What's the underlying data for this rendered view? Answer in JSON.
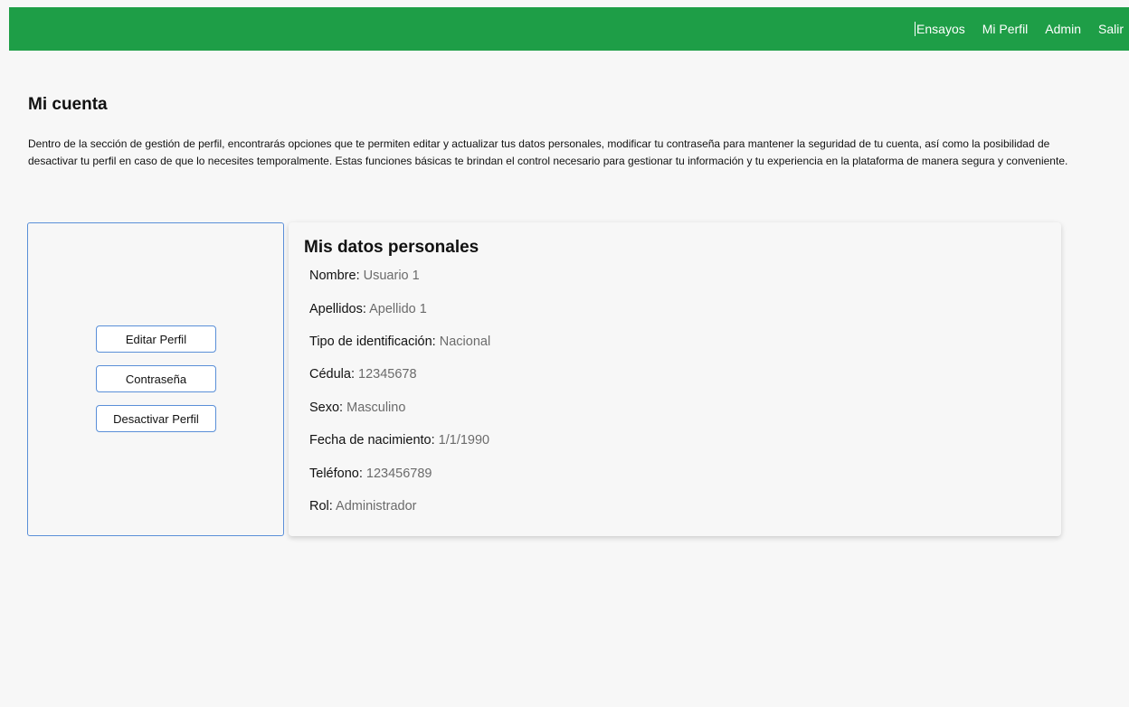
{
  "navbar": {
    "links": [
      "Ensayos",
      "Mi Perfil",
      "Admin",
      "Salir"
    ],
    "color": "#1e9e47"
  },
  "page": {
    "title": "Mi cuenta",
    "intro": "Dentro de la sección de gestión de perfil, encontrarás opciones que te permiten editar y actualizar tus datos personales, modificar tu contraseña para mantener la seguridad de tu cuenta, así como la posibilidad de desactivar tu perfil en caso de que lo necesites temporalmente. Estas funciones básicas te brindan el control necesario para gestionar tu información y tu experiencia en la plataforma de manera segura y conveniente."
  },
  "actions": {
    "edit_label": "Editar Perfil",
    "password_label": "Contraseña",
    "deactivate_label": "Desactivar Perfil"
  },
  "personal": {
    "title": "Mis datos personales",
    "fields": [
      {
        "label": "Nombre:",
        "value": "Usuario 1"
      },
      {
        "label": "Apellidos:",
        "value": "Apellido 1"
      },
      {
        "label": "Tipo de identificación:",
        "value": "Nacional"
      },
      {
        "label": "Cédula:",
        "value": "12345678"
      },
      {
        "label": "Sexo:",
        "value": "Masculino"
      },
      {
        "label": "Fecha de nacimiento:",
        "value": "1/1/1990"
      },
      {
        "label": "Teléfono:",
        "value": "123456789"
      },
      {
        "label": "Rol:",
        "value": "Administrador"
      }
    ]
  }
}
